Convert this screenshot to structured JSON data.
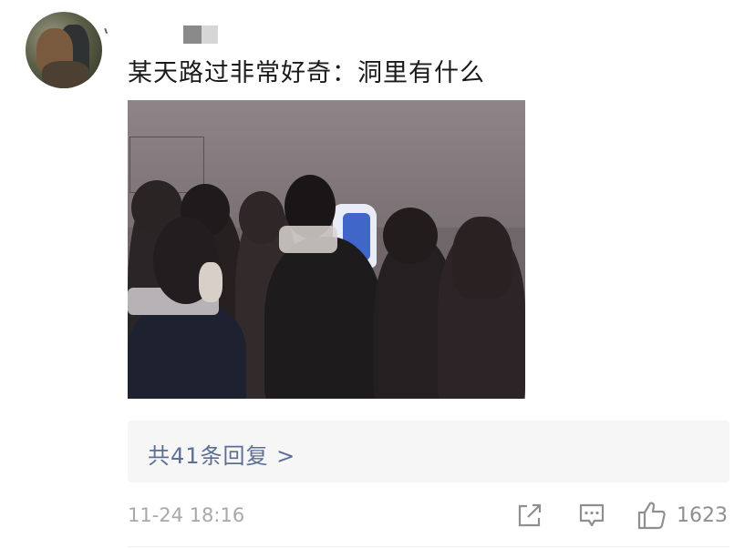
{
  "post": {
    "text": "某天路过非常好奇：洞里有什么",
    "timestamp": "11-24 18:16"
  },
  "replies": {
    "label": "共41条回复 >"
  },
  "actions": {
    "share_icon": "share-icon",
    "comment_icon": "comment-icon",
    "like_icon": "thumbs-up-icon",
    "like_count": "1623"
  },
  "colors": {
    "link": "#5b6f95",
    "meta": "#a8a8a8",
    "reply_bg": "#f6f6f6"
  }
}
